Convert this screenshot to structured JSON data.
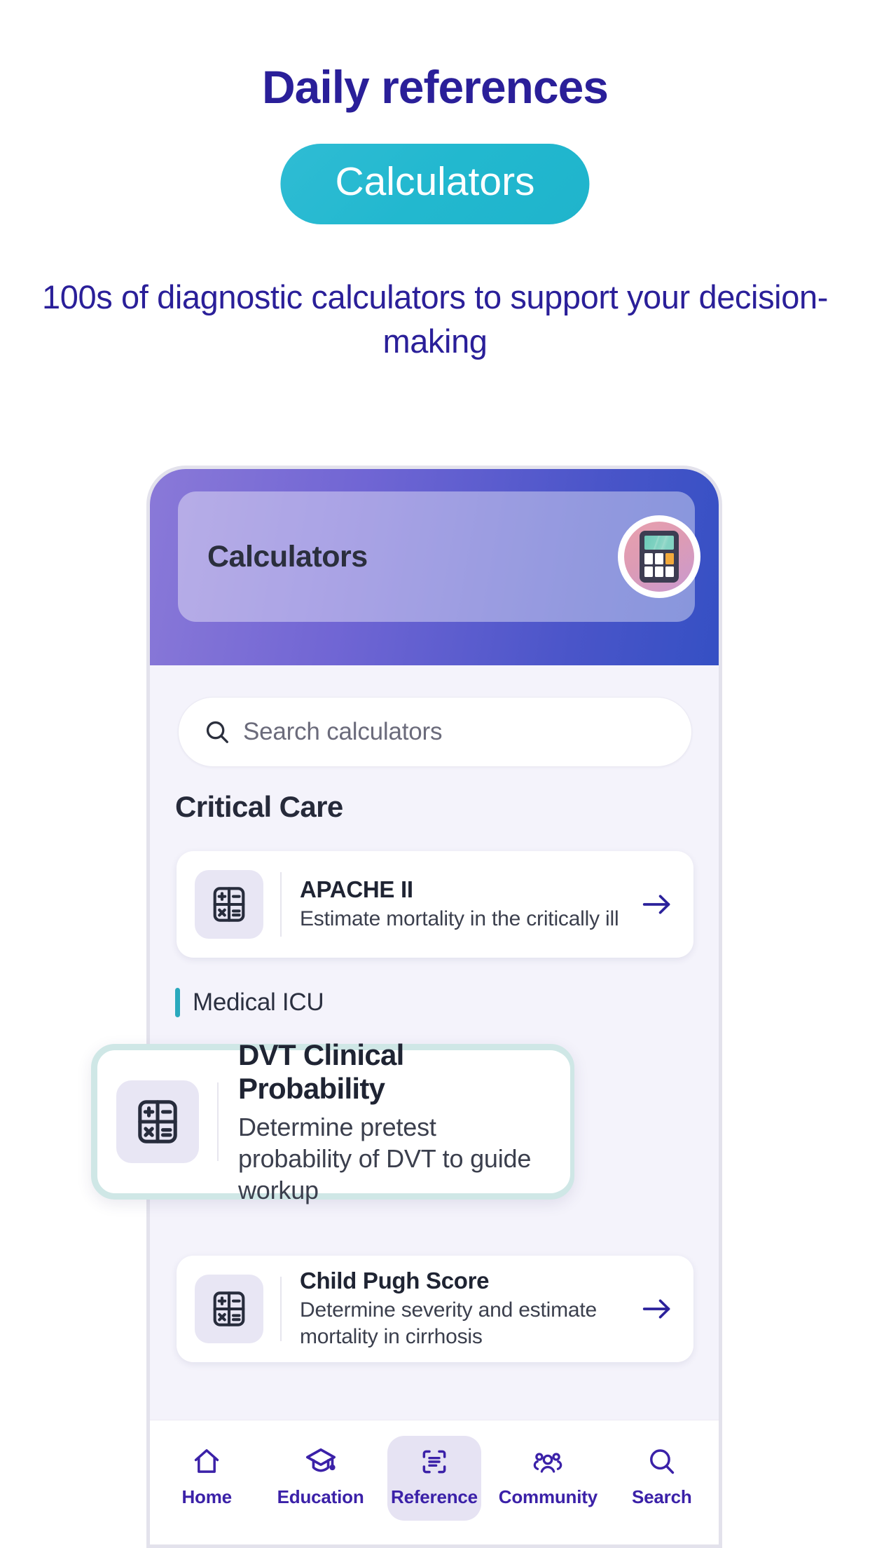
{
  "promo": {
    "title": "Daily references",
    "pill_label": "Calculators",
    "subtitle": "100s of diagnostic calculators to support your decision-making",
    "title_color": "#2a1f99",
    "pill_color": "#22b8cf"
  },
  "app": {
    "header": {
      "title": "Calculators",
      "badge_icon": "calculator-icon",
      "gradient_from": "#8a79d8",
      "gradient_to": "#3550c4"
    },
    "search": {
      "placeholder": "Search calculators",
      "icon": "search-icon"
    },
    "section": {
      "title": "Critical Care"
    },
    "subcategory": {
      "label": "Medical ICU",
      "accent_color": "#2aa9bd"
    },
    "cards": [
      {
        "title": "APACHE II",
        "desc": "Estimate mortality in the critically ill",
        "icon": "calculator-icon",
        "arrow": "arrow-right-icon"
      },
      {
        "title": "Child Pugh Score",
        "desc": "Determine severity and estimate mortality in cirrhosis",
        "icon": "calculator-icon",
        "arrow": "arrow-right-icon"
      }
    ],
    "highlight_card": {
      "title": "DVT Clinical Probability",
      "desc": "Determine pretest probability of DVT to guide workup",
      "icon": "calculator-icon",
      "glow_color": "#cfe7e6"
    },
    "bottom_nav": {
      "active_color": "#3b21a8",
      "items": [
        {
          "label": "Home",
          "icon": "home-icon",
          "active": false
        },
        {
          "label": "Education",
          "icon": "graduation-cap-icon",
          "active": false
        },
        {
          "label": "Reference",
          "icon": "document-scan-icon",
          "active": true
        },
        {
          "label": "Community",
          "icon": "people-group-icon",
          "active": false
        },
        {
          "label": "Search",
          "icon": "search-icon",
          "active": false
        }
      ]
    }
  }
}
